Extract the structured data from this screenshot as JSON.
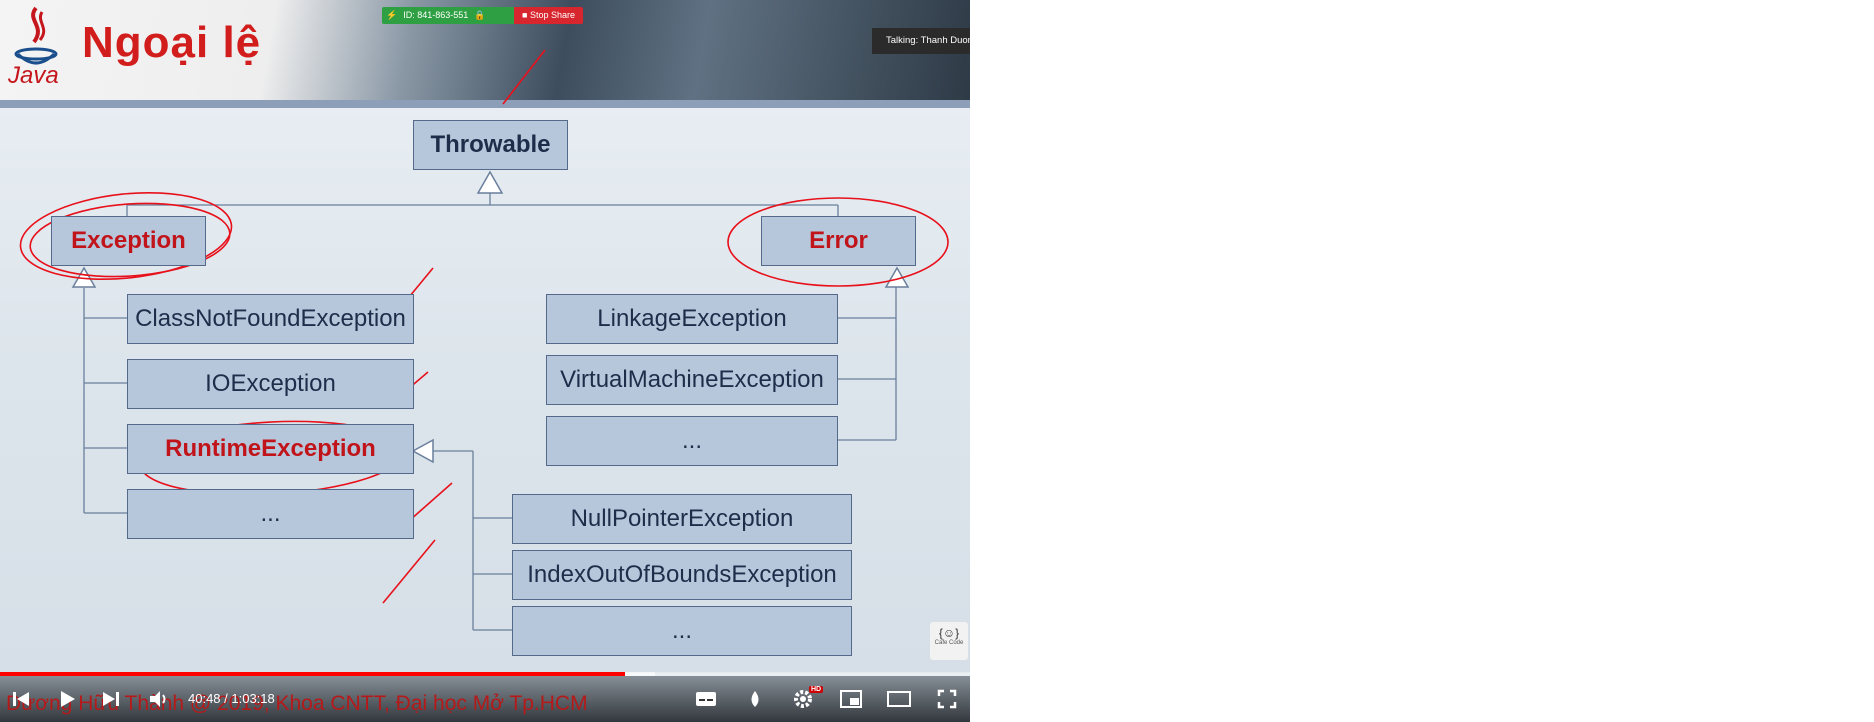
{
  "slide": {
    "title": "Ngoại lệ",
    "java_label": "Java",
    "footer": "Dương Hữu Thành @ 2019, Khoa CNTT, Đại học Mở Tp.HCM"
  },
  "zoom": {
    "meeting_id": "ID: 841-863-551",
    "stop_share_label": "Stop Share",
    "talking": "Talking: Thanh Duong"
  },
  "diagram": {
    "root": "Throwable",
    "exception": "Exception",
    "error": "Error",
    "exception_children": [
      "ClassNotFoundException",
      "IOException",
      "RuntimeException",
      "..."
    ],
    "error_children": [
      "LinkageException",
      "VirtualMachineException",
      "..."
    ],
    "runtime_children": [
      "NullPointerException",
      "IndexOutOfBoundsException",
      "..."
    ]
  },
  "player": {
    "time_display": "40:48 / 1:03:18",
    "progress_fraction": 0.644,
    "buffer_fraction": 0.675,
    "hd_badge": "HD",
    "cafe_logo": "Cafe Code",
    "colors": {
      "progress": "#ff0000",
      "title_red": "#d21d1d",
      "annotation": "#e8101a"
    }
  }
}
